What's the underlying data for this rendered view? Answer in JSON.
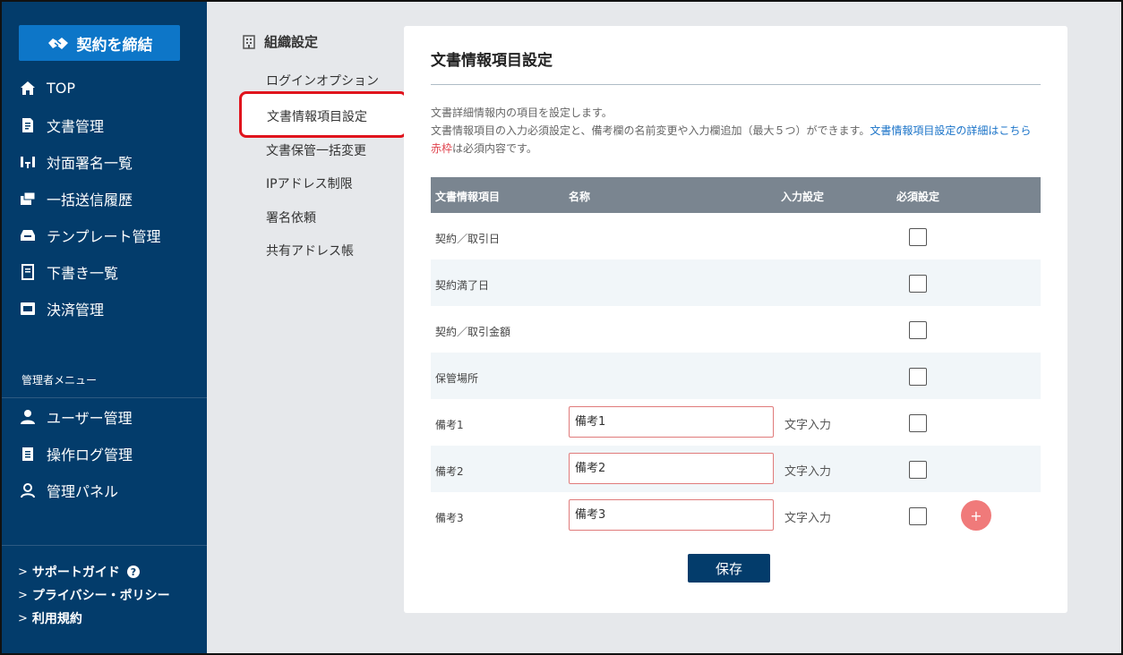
{
  "sidebar": {
    "contract_button": "契約を締結",
    "nav": [
      {
        "label": "TOP",
        "icon": "home-icon"
      },
      {
        "label": "文書管理",
        "icon": "document-icon"
      },
      {
        "label": "対面署名一覧",
        "icon": "face-to-face-icon"
      },
      {
        "label": "一括送信履歴",
        "icon": "bulk-send-icon"
      },
      {
        "label": "テンプレート管理",
        "icon": "template-icon"
      },
      {
        "label": "下書き一覧",
        "icon": "draft-icon"
      },
      {
        "label": "決済管理",
        "icon": "pay-icon"
      }
    ],
    "admin_title": "管理者メニュー",
    "admin_nav": [
      {
        "label": "ユーザー管理",
        "icon": "user-icon"
      },
      {
        "label": "操作ログ管理",
        "icon": "log-icon"
      },
      {
        "label": "管理パネル",
        "icon": "admin-panel-icon"
      }
    ],
    "footer": [
      {
        "label": "サポートガイド"
      },
      {
        "label": "プライバシー・ポリシー"
      },
      {
        "label": "利用規約"
      }
    ]
  },
  "subnav": {
    "title": "組織設定",
    "items": [
      "ログインオプション",
      "文書情報項目設定",
      "文書保管一括変更",
      "IPアドレス制限",
      "署名依頼",
      "共有アドレス帳"
    ]
  },
  "panel": {
    "title": "文書情報項目設定",
    "desc_line1": "文書詳細情報内の項目を設定します。",
    "desc_line2": "文書情報項目の入力必須設定と、備考欄の名前変更や入力欄追加（最大５つ）ができます。",
    "desc_link": "文書情報項目設定の詳細はこちら",
    "desc_red": "赤枠",
    "desc_line3_rest": "は必須内容です。",
    "table": {
      "headers": [
        "文書情報項目",
        "名称",
        "入力設定",
        "必須設定"
      ],
      "rows": [
        {
          "item": "契約／取引日",
          "name": "",
          "input": ""
        },
        {
          "item": "契約満了日",
          "name": "",
          "input": ""
        },
        {
          "item": "契約／取引金額",
          "name": "",
          "input": ""
        },
        {
          "item": "保管場所",
          "name": "",
          "input": ""
        },
        {
          "item": "備考1",
          "name": "備考1",
          "input": "文字入力"
        },
        {
          "item": "備考2",
          "name": "備考2",
          "input": "文字入力"
        },
        {
          "item": "備考3",
          "name": "備考3",
          "input": "文字入力"
        }
      ]
    },
    "add_label": "+",
    "save_label": "保存"
  },
  "colors": {
    "sidebar_bg": "#033c6b",
    "accent": "#0d76c8",
    "highlight": "#e0141d",
    "add_button": "#f07a7a"
  }
}
